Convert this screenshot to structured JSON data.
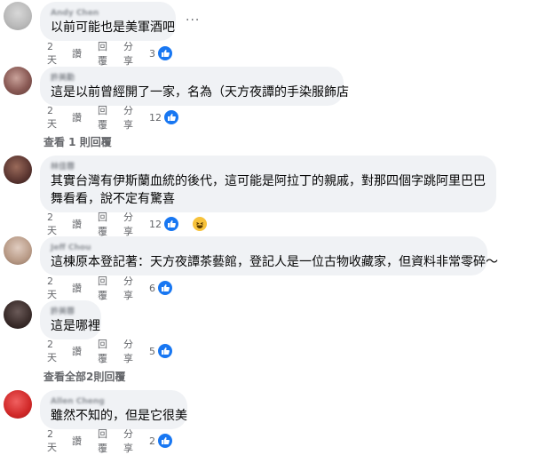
{
  "comments": [
    {
      "author": "Andy Chen",
      "text": "以前可能也是美軍酒吧",
      "time": "2天",
      "like": "讚",
      "reply": "回覆",
      "share": "分享",
      "reactions": "3"
    },
    {
      "author": "許美勤",
      "text": "這是以前曾經開了一家，名為（天方夜譚的手染服飾店",
      "time": "2天",
      "like": "讚",
      "reply": "回覆",
      "share": "分享",
      "reactions": "12"
    },
    {
      "author": "林佳蓉",
      "text": "其實台灣有伊斯蘭血統的後代，這可能是阿拉丁的親戚，對那四個字跳阿里巴巴舞看看，說不定有驚喜",
      "time": "2天",
      "like": "讚",
      "reply": "回覆",
      "share": "分享",
      "reactions": "12"
    },
    {
      "author": "Jeff Chou",
      "text": "這棟原本登記著：天方夜譚茶藝館，登記人是一位古物收藏家，但資料非常零碎～",
      "time": "2天",
      "like": "讚",
      "reply": "回覆",
      "share": "分享",
      "reactions": "6"
    },
    {
      "author": "許美蓉",
      "text": "這是哪裡",
      "time": "2天",
      "like": "讚",
      "reply": "回覆",
      "share": "分享",
      "reactions": "5"
    },
    {
      "author": "Allen Cheng",
      "text": "雖然不知的，但是它很美",
      "time": "2天",
      "like": "讚",
      "reply": "回覆",
      "share": "分享",
      "reactions": "2"
    }
  ],
  "view_replies_1": "查看 1 則回覆",
  "view_replies_2": "查看全部2則回覆",
  "more_label": "···",
  "icons": {
    "like": "thumbs-up-icon",
    "haha": "haha-icon",
    "more": "more-options-icon"
  },
  "colors": {
    "like_blue": "#1877f2",
    "bubble_bg": "#f0f2f5",
    "meta_gray": "#65676b",
    "haha_yellow": "#f7c23a"
  }
}
